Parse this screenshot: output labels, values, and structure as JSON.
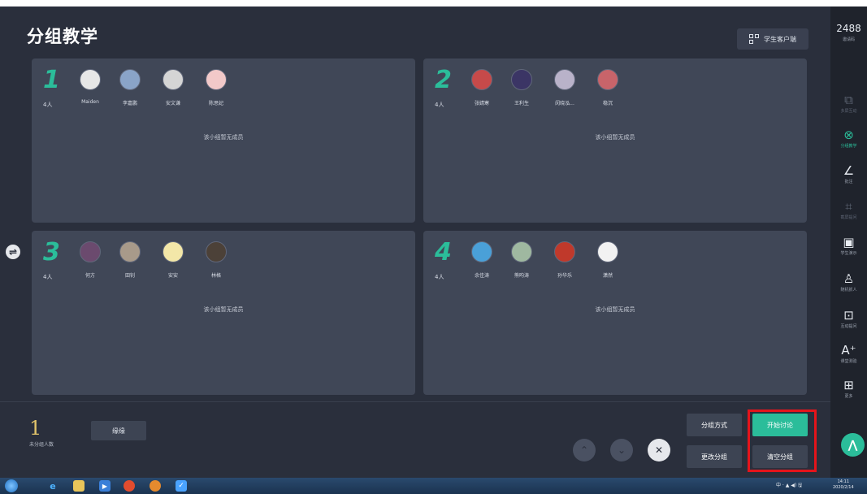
{
  "page": {
    "title": "分组教学"
  },
  "client_button": {
    "label": "学生客户端",
    "icon": "qr-code-icon"
  },
  "groups": [
    {
      "number": "1",
      "count": "4人",
      "empty_text": "该小组暂无成员",
      "members": [
        {
          "name": "Maiden",
          "color": "#e7e7e7"
        },
        {
          "name": "李嘉鹏",
          "color": "#8aa4c8"
        },
        {
          "name": "安文谦",
          "color": "#d5d5d5"
        },
        {
          "name": "陈思妃",
          "color": "#f2c9c9"
        }
      ]
    },
    {
      "number": "2",
      "count": "4人",
      "empty_text": "该小组暂无成员",
      "members": [
        {
          "name": "张婧寒",
          "color": "#c64a4a"
        },
        {
          "name": "王利生",
          "color": "#3b3565"
        },
        {
          "name": "闵晓泓...",
          "color": "#b9b2c9"
        },
        {
          "name": "稳沉",
          "color": "#c8646a"
        }
      ]
    },
    {
      "number": "3",
      "count": "4人",
      "empty_text": "该小组暂无成员",
      "members": [
        {
          "name": "何方",
          "color": "#6b4a6e"
        },
        {
          "name": "田钊",
          "color": "#a89a8a"
        },
        {
          "name": "安安",
          "color": "#f3e7a8"
        },
        {
          "name": "林格",
          "color": "#4c4138"
        }
      ]
    },
    {
      "number": "4",
      "count": "4人",
      "empty_text": "该小组暂无成员",
      "members": [
        {
          "name": "余佳涛",
          "color": "#4aa0d8"
        },
        {
          "name": "熊昀涛",
          "color": "#9fb8a0"
        },
        {
          "name": "孙华乐",
          "color": "#c0392b"
        },
        {
          "name": "潇然",
          "color": "#f2f2f2"
        }
      ]
    }
  ],
  "footer": {
    "ungrouped_count": "1",
    "ungrouped_label": "未分组人数",
    "pending_member": "缘缘",
    "buttons": {
      "group_method": "分组方式",
      "start_discussion": "开始讨论",
      "change_group": "更改分组",
      "clear_group": "清空分组"
    }
  },
  "sidebar": {
    "code": "2488",
    "code_label": "邀请码",
    "items": [
      {
        "label": "多屏互动",
        "icon": "screen-icon",
        "state": "dim"
      },
      {
        "label": "分组教学",
        "icon": "group-icon",
        "state": "active"
      },
      {
        "label": "批注",
        "icon": "pen-icon",
        "state": "normal"
      },
      {
        "label": "截屏提问",
        "icon": "crop-icon",
        "state": "dim"
      },
      {
        "label": "学生演示",
        "icon": "play-icon",
        "state": "normal"
      },
      {
        "label": "随机抓人",
        "icon": "person-icon",
        "state": "normal"
      },
      {
        "label": "互动提问",
        "icon": "chat-icon",
        "state": "normal"
      },
      {
        "label": "课堂测验",
        "icon": "quiz-icon",
        "state": "normal"
      },
      {
        "label": "更多",
        "icon": "grid-icon",
        "state": "normal"
      }
    ]
  },
  "taskbar": {
    "tray_text": "中 · ▲ ◀) 🖫",
    "time": "14:11",
    "date": "2020/2/14"
  },
  "colors": {
    "accent": "#2bbd9a",
    "highlight": "#e5141b",
    "background": "#2a2f3c",
    "panel": "#404757"
  }
}
